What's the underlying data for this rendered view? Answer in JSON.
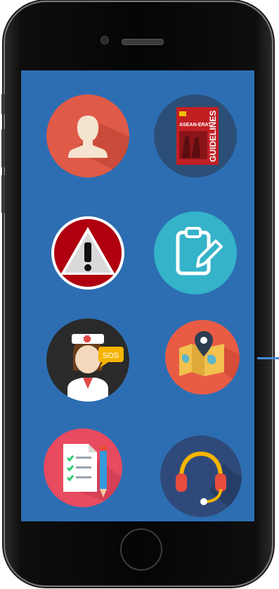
{
  "screen": {
    "background": "#2d6eb3",
    "apps": [
      {
        "icon": "user-profile-icon",
        "color": "#e05a48"
      },
      {
        "icon": "guidelines-book-icon",
        "color": "#2c4f78",
        "book_title": "GUIDELINES",
        "book_subtitle": "ASEAN-ERAT"
      },
      {
        "icon": "warning-icon",
        "color": "#b00010"
      },
      {
        "icon": "clipboard-edit-icon",
        "color": "#34b3c9"
      },
      {
        "icon": "nurse-sos-icon",
        "color": "#2a2a2a",
        "bubble_text": "SOS"
      },
      {
        "icon": "map-location-icon",
        "color": "#e85c45"
      },
      {
        "icon": "checklist-icon",
        "color": "#e84a5f"
      },
      {
        "icon": "headset-support-icon",
        "color": "#2f4a7a"
      }
    ]
  }
}
